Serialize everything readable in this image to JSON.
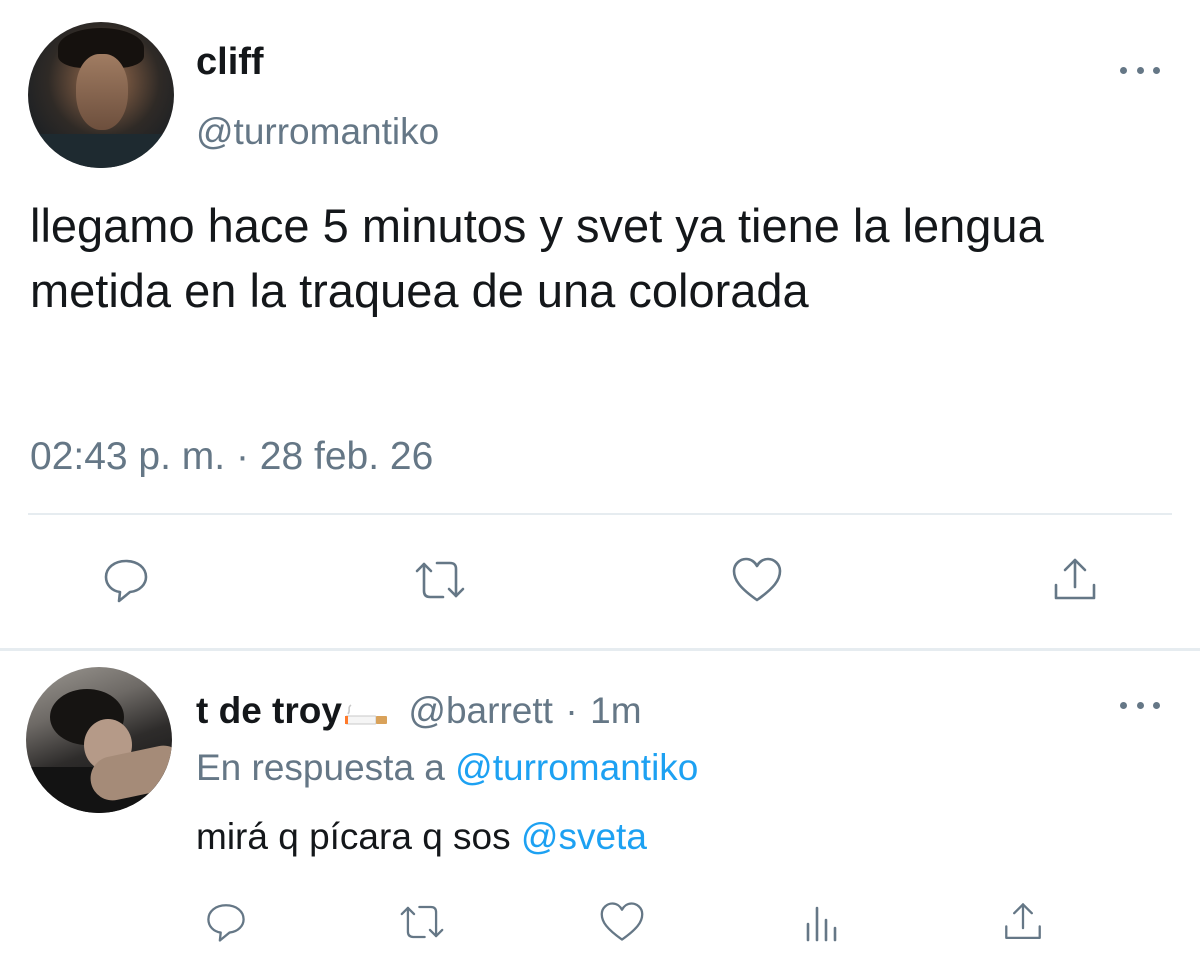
{
  "main_tweet": {
    "display_name": "cliff",
    "handle": "@turromantiko",
    "text": "llegamo hace 5 minutos y svet ya tiene la lengua metida en la traquea de una colorada",
    "timestamp": "02:43 p. m. · 28 feb. 26",
    "actions": [
      "reply-icon",
      "retweet-icon",
      "like-icon",
      "share-icon"
    ]
  },
  "reply": {
    "display_name": "t de troy",
    "emoji": "cigarette-icon",
    "handle": "@barrett",
    "separator": "·",
    "time": "1m",
    "in_reply_prefix": "En respuesta a",
    "in_reply_handle": "@turromantiko",
    "text": "mirá q pícara q sos",
    "mention": "@sveta",
    "actions": [
      "reply-icon",
      "retweet-icon",
      "like-icon",
      "analytics-icon",
      "share-icon"
    ]
  },
  "colors": {
    "accent": "#1da1f2",
    "secondary_text": "#657786",
    "primary_text": "#14171a",
    "divider": "#e6ecf0"
  }
}
